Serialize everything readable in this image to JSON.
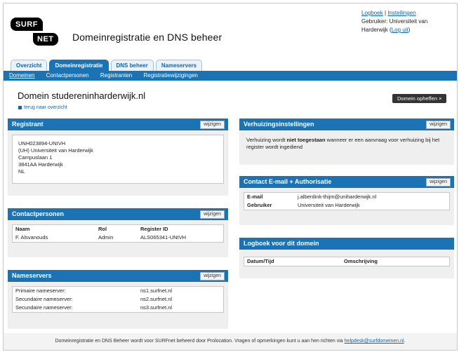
{
  "header": {
    "logo_top": "SURF",
    "logo_bottom": "NET",
    "title": "Domeinregistratie en DNS beheer",
    "logboek": "Logboek",
    "separator": "|",
    "instellingen": "Instellingen",
    "user_label": "Gebruiker: Universiteit van Harderwijk",
    "logout": "Log uit"
  },
  "tabs": [
    {
      "label": "Overzicht",
      "active": false
    },
    {
      "label": "Domeinregistratie",
      "active": true
    },
    {
      "label": "DNS beheer",
      "active": false
    },
    {
      "label": "Nameservers",
      "active": false
    }
  ],
  "subnav": [
    "Domeinen",
    "Contactpersonen",
    "Registranten",
    "Registratiewijzigingen"
  ],
  "page": {
    "title": "Domein studereninharderwijk.nl",
    "back": "terug naar overzicht",
    "cancel_domain": "Domein opheffen ×"
  },
  "edit_label": "wijzigen",
  "registrant": {
    "title": "Registrant",
    "lines": [
      "UNH023894-UNIVH",
      "(UH) Universiteit van Harderwijk",
      "Campuslaan 1",
      "3841AA Harderwijk",
      "NL"
    ]
  },
  "contacts": {
    "title": "Contactpersonen",
    "columns": [
      "Naam",
      "Rol",
      "Register ID"
    ],
    "rows": [
      [
        "F. Alsvanouds",
        "Admin",
        "ALS065341-UNIVH"
      ]
    ]
  },
  "nameservers": {
    "title": "Nameservers",
    "rows": [
      [
        "Primaire nameserver:",
        "ns1.surfnet.nl"
      ],
      [
        "Secundaire nameserver:",
        "ns2.surfnet.nl"
      ],
      [
        "Secundaire nameserver:",
        "ns3.surfnet.nl"
      ]
    ]
  },
  "transfer": {
    "title": "Verhuizingsinstellingen",
    "text_before": "Verhuizing wordt ",
    "text_bold": "niet toegestaan",
    "text_after": " wanneer er een aanvraag voor verhuizing bij het register wordt ingediend"
  },
  "contact_auth": {
    "title": "Contact E-mail + Authorisatie",
    "rows": [
      [
        "E-mail",
        "j.alberdink-thijm@uniharderwijk.nl"
      ],
      [
        "Gebruiker",
        "Universiteit van Harderwijk"
      ]
    ]
  },
  "log": {
    "title": "Logboek voor dit domein",
    "columns": [
      "Datum/Tijd",
      "Omschrijving"
    ]
  },
  "footer": {
    "text": "Domeinregistratie en DNS Beheer wordt voor SURFnet beheerd door Prolocation. Vragen of opmerkingen kunt u aan hen richten via ",
    "email": "helpdesk@surfdomeinen.nl",
    "end": "."
  }
}
